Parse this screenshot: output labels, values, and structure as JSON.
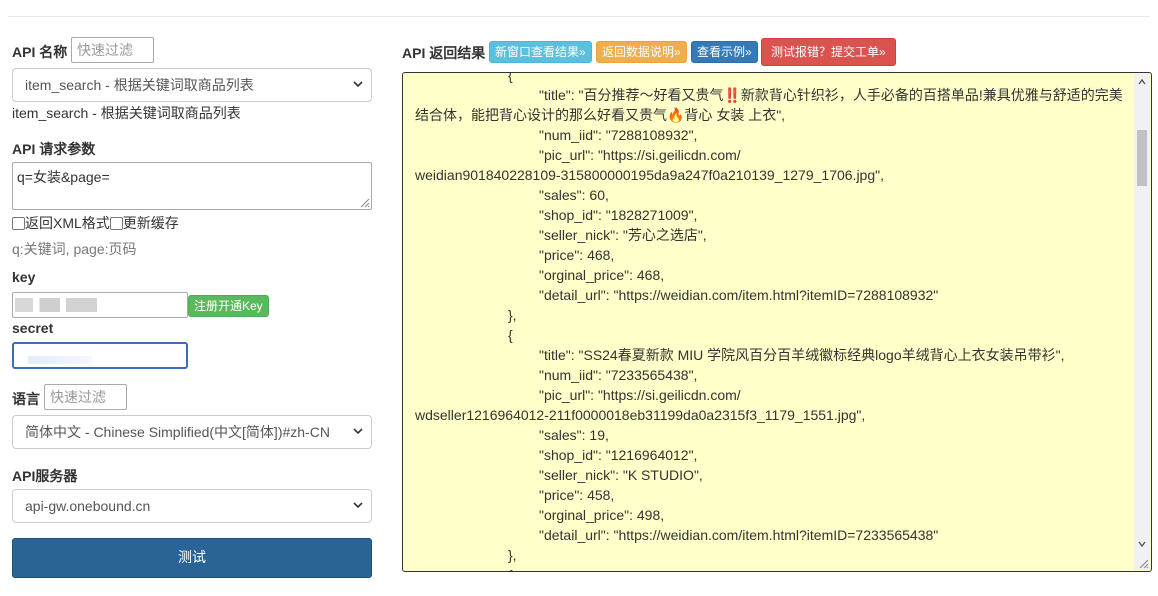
{
  "left": {
    "api_name_label": "API 名称",
    "api_name_filter_placeholder": "快速过滤",
    "api_select_value": "item_search - 根据关键词取商品列表",
    "api_description": "item_search - 根据关键词取商品列表",
    "params_label": "API 请求参数",
    "params_value": "q=女装&page=",
    "xml_checkbox_label": "返回XML格式",
    "cache_checkbox_label": "更新缓存",
    "params_hint": "q:关键词, page:页码",
    "key_label": "key",
    "register_button": "注册开通Key",
    "secret_label": "secret",
    "language_label": "语言",
    "language_filter_placeholder": "快速过滤",
    "language_select_value": "简体中文 - Chinese Simplified(中文[简体])#zh-CN",
    "server_label": "API服务器",
    "server_select_value": "api-gw.onebound.cn",
    "test_button": "测试"
  },
  "right": {
    "result_label": "API 返回结果",
    "buttons": {
      "new_window": "新窗口查看结果»",
      "data_doc": "返回数据说明»",
      "example": "查看示例»",
      "report": "测试报错？提交工单»"
    },
    "output_lines": [
      "{",
      "\"title\": \"百分推荐～好看又贵气‼️新款背心针织衫，人手必备的百搭单品!兼具优雅与舒适的完美",
      "结合体，能把背心设计的那么好看又贵气🔥背心 女装 上衣\",",
      "\"num_iid\": \"7288108932\",",
      "\"pic_url\": \"https://si.geilicdn.com/",
      "weidian901840228109-315800000195da9a247f0a210139_1279_1706.jpg\",",
      "\"sales\": 60,",
      "\"shop_id\": \"1828271009\",",
      "\"seller_nick\": \"芳心之选店\",",
      "\"price\": 468,",
      "\"orginal_price\": 468,",
      "\"detail_url\": \"https://weidian.com/item.html?itemID=7288108932\"",
      "},",
      "{",
      "\"title\": \"SS24春夏新款 MIU 学院风百分百羊绒徽标经典logo羊绒背心上衣女装吊带衫\",",
      "\"num_iid\": \"7233565438\",",
      "\"pic_url\": \"https://si.geilicdn.com/",
      "wdseller1216964012-211f0000018eb31199da0a2315f3_1179_1551.jpg\",",
      "\"sales\": 19,",
      "\"shop_id\": \"1216964012\",",
      "\"seller_nick\": \"K STUDIO\",",
      "\"price\": 458,",
      "\"orginal_price\": 498,",
      "\"detail_url\": \"https://weidian.com/item.html?itemID=7233565438\"",
      "},",
      "{"
    ]
  },
  "colors": {
    "btn_info": "#5bc0de",
    "btn_warning": "#f0ad4e",
    "btn_primary": "#337ab7",
    "btn_danger": "#d9534f",
    "btn_success": "#5cb85c",
    "output_bg": "#ffffc9",
    "submit_bg": "#2a6496"
  }
}
